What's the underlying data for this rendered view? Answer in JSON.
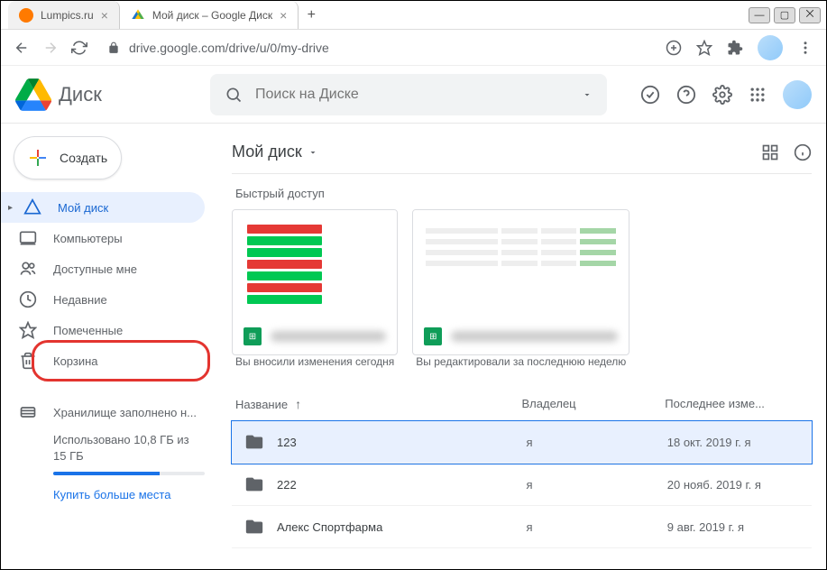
{
  "tabs": [
    {
      "title": "Lumpics.ru",
      "favicon_color": "#ff7a00"
    },
    {
      "title": "Мой диск – Google Диск",
      "favicon": "drive"
    }
  ],
  "url": "drive.google.com/drive/u/0/my-drive",
  "app_name": "Диск",
  "search_placeholder": "Поиск на Диске",
  "create_label": "Создать",
  "sidebar": [
    {
      "id": "mydrive",
      "label": "Мой диск",
      "active": true,
      "expandable": true
    },
    {
      "id": "computers",
      "label": "Компьютеры"
    },
    {
      "id": "shared",
      "label": "Доступные мне"
    },
    {
      "id": "recent",
      "label": "Недавние"
    },
    {
      "id": "starred",
      "label": "Помеченные"
    },
    {
      "id": "trash",
      "label": "Корзина",
      "highlighted": true
    }
  ],
  "storage": {
    "title": "Хранилище заполнено н...",
    "usage": "Использовано 10,8 ГБ из 15 ГБ",
    "link": "Купить больше места"
  },
  "breadcrumb": "Мой диск",
  "quick_title": "Быстрый доступ",
  "quick_cards": [
    {
      "sub": "Вы вносили изменения сегодня",
      "thumb": "red-green"
    },
    {
      "sub": "Вы редактировали за последнюю неделю",
      "thumb": "table"
    }
  ],
  "columns": {
    "name": "Название",
    "owner": "Владелец",
    "modified": "Последнее изме..."
  },
  "files": [
    {
      "name": "123",
      "owner": "я",
      "modified": "18 окт. 2019 г. я",
      "selected": true
    },
    {
      "name": "222",
      "owner": "я",
      "modified": "20 нояб. 2019 г. я"
    },
    {
      "name": "Алекс Спортфарма",
      "owner": "я",
      "modified": "9 авг. 2019 г. я"
    }
  ]
}
